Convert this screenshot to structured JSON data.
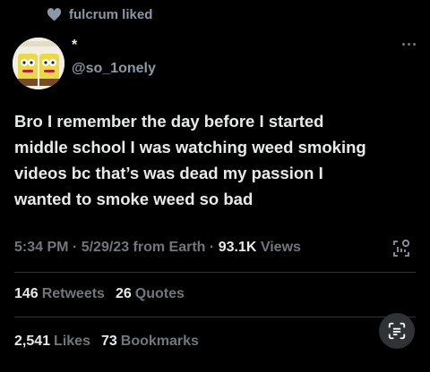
{
  "social_context": {
    "text": "fulcrum liked",
    "icon": "heart-icon"
  },
  "author": {
    "display_name": "*",
    "handle": "@so_1onely",
    "avatar": "cartoon-characters-avatar"
  },
  "tweet": {
    "lines": [
      "Bro I remember the day before I started",
      "middle school I was watching weed smoking",
      "videos bc that’s was dead my passion I",
      "wanted to smoke weed so bad"
    ]
  },
  "meta": {
    "time": "5:34 PM",
    "date": "5/29/23",
    "source": "from Earth",
    "separator": "·",
    "views_count": "93.1K",
    "views_label": "Views"
  },
  "stats_row1": [
    {
      "count": "146",
      "label": "Retweets"
    },
    {
      "count": "26",
      "label": "Quotes"
    }
  ],
  "stats_row2": [
    {
      "count": "2,541",
      "label": "Likes"
    },
    {
      "count": "73",
      "label": "Bookmarks"
    }
  ],
  "icons": {
    "analytics": "analytics-icon",
    "scan": "scan-text-icon",
    "more": "more-icon"
  },
  "colors": {
    "background": "#000000",
    "text": "#e7e9ea",
    "muted": "#71767b",
    "divider": "#2f3336"
  }
}
